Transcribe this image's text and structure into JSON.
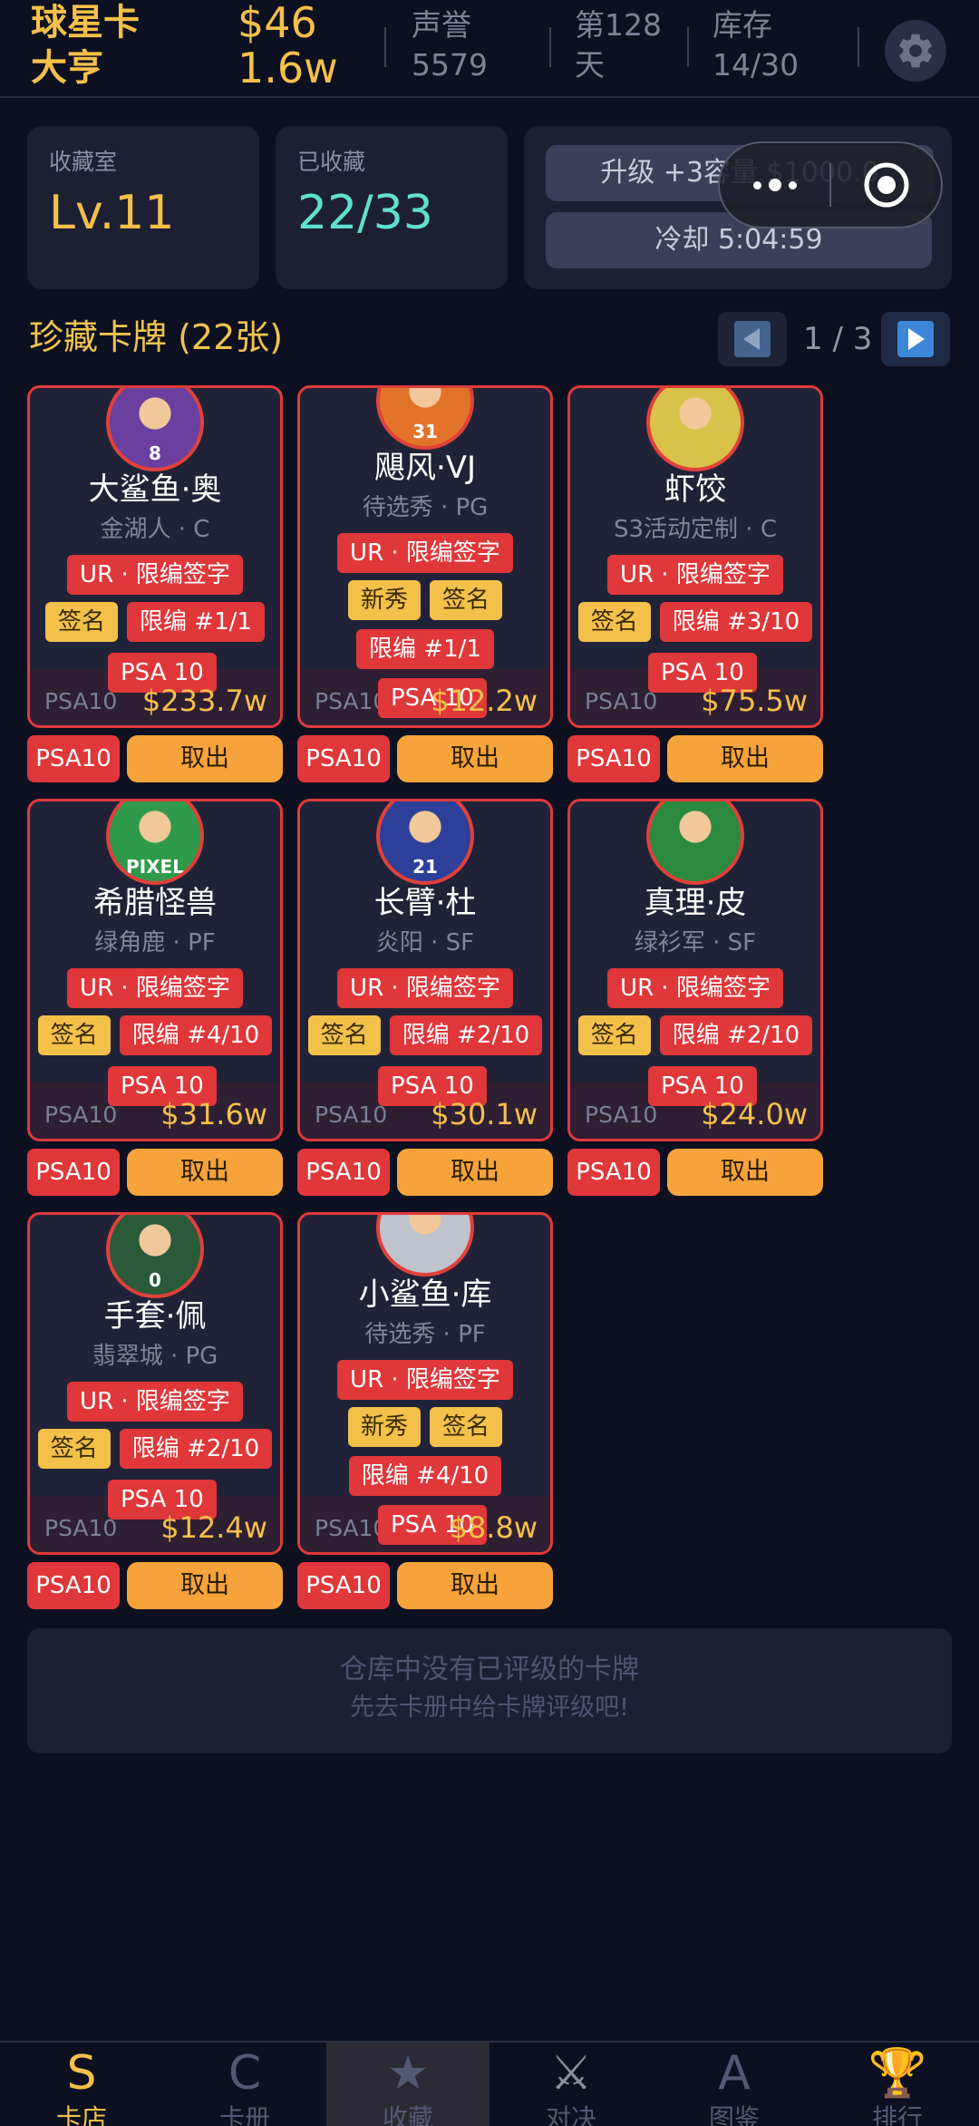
{
  "header": {
    "title": "球星卡大亨",
    "money": "$46",
    "money_sub": "1.6w",
    "reputation_label": "声誉",
    "reputation_value": "5579",
    "day": "第128天",
    "inventory_label": "库存",
    "inventory_value": "14/30",
    "settings_icon": "gear-icon"
  },
  "stats": {
    "room_label": "收藏室",
    "room_level": "Lv.11",
    "collected_label": "已收藏",
    "collected_value": "22/33",
    "upgrade_button": "升级 +3容量 $1000.0",
    "cooldown_button": "冷却 5:04:59",
    "colors": {
      "level": "#f5c04a",
      "collected": "#5fe0cf"
    }
  },
  "section": {
    "title": "珍藏卡牌 (22张)",
    "page": "1 / 3",
    "prev_icon": "triangle-left-icon",
    "next_icon": "triangle-right-icon"
  },
  "cards": [
    {
      "name": "大鲨鱼·奥",
      "team": "金湖人 · C",
      "rarity": "UR · 限编签字",
      "row2": [
        "签名",
        "限编 #1/1"
      ],
      "row3": [],
      "grade_tag": "PSA 10",
      "grade": "PSA10",
      "price": "$233.7w",
      "psa_btn": "PSA10",
      "take_btn": "取出",
      "avatar_jersey": "8",
      "avatar_color": "#6a3fa0"
    },
    {
      "name": "飓风·VJ",
      "team": "待选秀 · PG",
      "rarity": "UR · 限编签字",
      "row2": [
        "新秀",
        "签名"
      ],
      "row3": [
        "限编 #1/1"
      ],
      "grade_tag": "PSA 10",
      "grade": "PSA10",
      "price": "$12.2w",
      "psa_btn": "PSA10",
      "take_btn": "取出",
      "avatar_jersey": "31",
      "avatar_color": "#e2742a"
    },
    {
      "name": "虾饺",
      "team": "S3活动定制 · C",
      "rarity": "UR · 限编签字",
      "row2": [
        "签名",
        "限编 #3/10"
      ],
      "row3": [],
      "grade_tag": "PSA 10",
      "grade": "PSA10",
      "price": "$75.5w",
      "psa_btn": "PSA10",
      "take_btn": "取出",
      "avatar_jersey": "",
      "avatar_color": "#d9c24a"
    },
    {
      "name": "希腊怪兽",
      "team": "绿角鹿 · PF",
      "rarity": "UR · 限编签字",
      "row2": [
        "签名",
        "限编 #4/10"
      ],
      "row3": [],
      "grade_tag": "PSA 10",
      "grade": "PSA10",
      "price": "$31.6w",
      "psa_btn": "PSA10",
      "take_btn": "取出",
      "avatar_jersey": "PIXEL",
      "avatar_color": "#2f9a4a"
    },
    {
      "name": "长臂·杜",
      "team": "炎阳 · SF",
      "rarity": "UR · 限编签字",
      "row2": [
        "签名",
        "限编 #2/10"
      ],
      "row3": [],
      "grade_tag": "PSA 10",
      "grade": "PSA10",
      "price": "$30.1w",
      "psa_btn": "PSA10",
      "take_btn": "取出",
      "avatar_jersey": "21",
      "avatar_color": "#2e3f9a"
    },
    {
      "name": "真理·皮",
      "team": "绿衫军 · SF",
      "rarity": "UR · 限编签字",
      "row2": [
        "签名",
        "限编 #2/10"
      ],
      "row3": [],
      "grade_tag": "PSA 10",
      "grade": "PSA10",
      "price": "$24.0w",
      "psa_btn": "PSA10",
      "take_btn": "取出",
      "avatar_jersey": "",
      "avatar_color": "#2c8a3e"
    },
    {
      "name": "手套·佩",
      "team": "翡翠城 · PG",
      "rarity": "UR · 限编签字",
      "row2": [
        "签名",
        "限编 #2/10"
      ],
      "row3": [],
      "grade_tag": "PSA 10",
      "grade": "PSA10",
      "price": "$12.4w",
      "psa_btn": "PSA10",
      "take_btn": "取出",
      "avatar_jersey": "0",
      "avatar_color": "#2a5a3a"
    },
    {
      "name": "小鲨鱼·库",
      "team": "待选秀 · PF",
      "rarity": "UR · 限编签字",
      "row2": [
        "新秀",
        "签名"
      ],
      "row3": [
        "限编 #4/10"
      ],
      "grade_tag": "PSA 10",
      "grade": "PSA10",
      "price": "$8.8w",
      "psa_btn": "PSA10",
      "take_btn": "取出",
      "avatar_jersey": "",
      "avatar_color": "#bfc3cc"
    }
  ],
  "empty_notice": {
    "line1": "仓库中没有已评级的卡牌",
    "line2": "先去卡册中给卡牌评级吧!"
  },
  "nav": [
    {
      "icon": "S",
      "label": "卡店",
      "color": "#f5c04a"
    },
    {
      "icon": "C",
      "label": "卡册",
      "color": "#545973"
    },
    {
      "icon": "★",
      "label": "收藏",
      "color": "#545973"
    },
    {
      "icon": "⚔",
      "label": "对决",
      "color": "#545973"
    },
    {
      "icon": "A",
      "label": "图鉴",
      "color": "#545973"
    },
    {
      "icon": "🏆",
      "label": "排行",
      "color": "#545973"
    }
  ]
}
